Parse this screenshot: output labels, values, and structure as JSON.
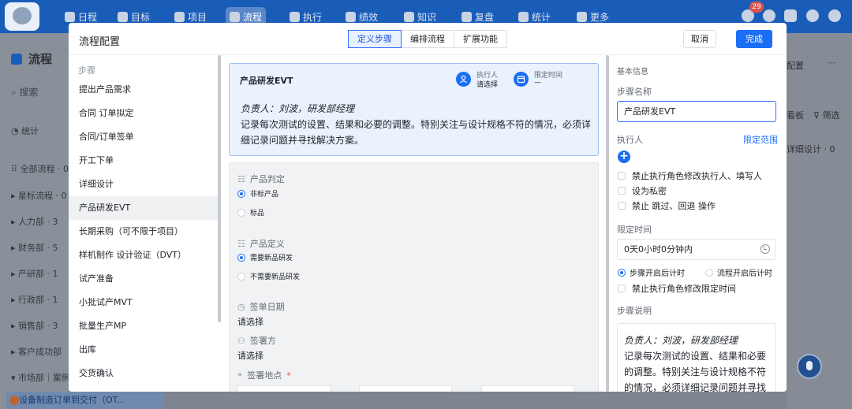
{
  "topnav": {
    "items": [
      {
        "label": "日程"
      },
      {
        "label": "目标"
      },
      {
        "label": "项目"
      },
      {
        "label": "流程"
      },
      {
        "label": "执行"
      },
      {
        "label": "绩效"
      },
      {
        "label": "知识"
      },
      {
        "label": "复盘"
      },
      {
        "label": "统计"
      },
      {
        "label": "更多"
      }
    ],
    "active": "流程",
    "notification_count": "29"
  },
  "background": {
    "page_title": "流程",
    "search_placeholder": "搜索",
    "stats_label": "统计",
    "sidebar_groups": [
      {
        "label": "全部流程 · 0"
      },
      {
        "label": "星标流程 · 0"
      },
      {
        "label": "人力部 · 3"
      },
      {
        "label": "财务部 · 5"
      },
      {
        "label": "产研部 · 1"
      },
      {
        "label": "行政部 · 1"
      },
      {
        "label": "销售部 · 3"
      },
      {
        "label": "客户成功部"
      },
      {
        "label": "市场部｜案例"
      }
    ],
    "bottom_item": "设备制造订单到交付（OT...",
    "right_labels": {
      "config": "配置",
      "board": "看板",
      "filter": "筛选",
      "detail": "详细设计 · 0"
    }
  },
  "modal": {
    "title": "流程配置",
    "tabs": [
      {
        "label": "定义步骤"
      },
      {
        "label": "编排流程"
      },
      {
        "label": "扩展功能"
      }
    ],
    "cancel_label": "取消",
    "done_label": "完成",
    "steps_header": "步骤",
    "steps": [
      {
        "label": "提出产品需求"
      },
      {
        "label": "合同 订单拟定"
      },
      {
        "label": "合同/订单签单"
      },
      {
        "label": "开工下单"
      },
      {
        "label": "详细设计"
      },
      {
        "label": "产品研发EVT"
      },
      {
        "label": "长期采购（可不限于项目）"
      },
      {
        "label": "样机制作 设计验证（DVT）"
      },
      {
        "label": "试产准备"
      },
      {
        "label": "小批试产MVT"
      },
      {
        "label": "批量生产MP"
      },
      {
        "label": "出库"
      },
      {
        "label": "交货确认"
      }
    ],
    "selected_step": "产品研发EVT",
    "card": {
      "title": "产品研发EVT",
      "executor_label": "执行人",
      "executor_value": "请选择",
      "deadline_label": "限定时间",
      "deadline_value": "—",
      "responsible": "负责人：刘波，研发部经理",
      "description": "记录每次测试的设置、结果和必要的调整。特别关注与设计规格不符的情况，必须详细记录问题并寻找解决方案。"
    },
    "form": {
      "product_judge": {
        "label": "产品判定",
        "options": [
          "非标产品",
          "标品"
        ],
        "selected": "非标产品"
      },
      "product_define": {
        "label": "产品定义",
        "options": [
          "需要新品研发",
          "不需要新品研发"
        ],
        "selected": "需要新品研发"
      },
      "sign_date": {
        "label": "签单日期",
        "value": "请选择"
      },
      "signer": {
        "label": "签署方",
        "value": "请选择"
      },
      "sign_location": {
        "label": "签署地点",
        "required_mark": "*"
      }
    },
    "right": {
      "section_basic": "基本信息",
      "name_label": "步骤名称",
      "name_value": "产品研发EVT",
      "executor_label": "执行人",
      "range_link": "限定范围",
      "add_symbol": "+",
      "checkboxes": [
        {
          "label": "禁止执行角色修改执行人、填写人"
        },
        {
          "label": "设为私密"
        },
        {
          "label": "禁止 跳过、回退 操作"
        }
      ],
      "time_label": "限定时间",
      "time_value": "0天0小时0分钟内",
      "timer_options": [
        "步骤开启后计时",
        "流程开启后计时"
      ],
      "timer_selected": "步骤开启后计时",
      "time_checkbox": "禁止执行角色修改限定时间",
      "desc_label": "步骤说明",
      "desc_responsible": "负责人：刘波，研发部经理",
      "desc_text": "记录每次测试的设置、结果和必要的调整。特别关注与设计规格不符的情况，必须详细记录问题并寻找"
    }
  },
  "colors": {
    "primary": "#1b6ef3",
    "nav_bg": "#1a5db8",
    "card_bg": "#eaf2fd",
    "card_border": "#9dbdf3",
    "overlay": "#7d8590"
  }
}
